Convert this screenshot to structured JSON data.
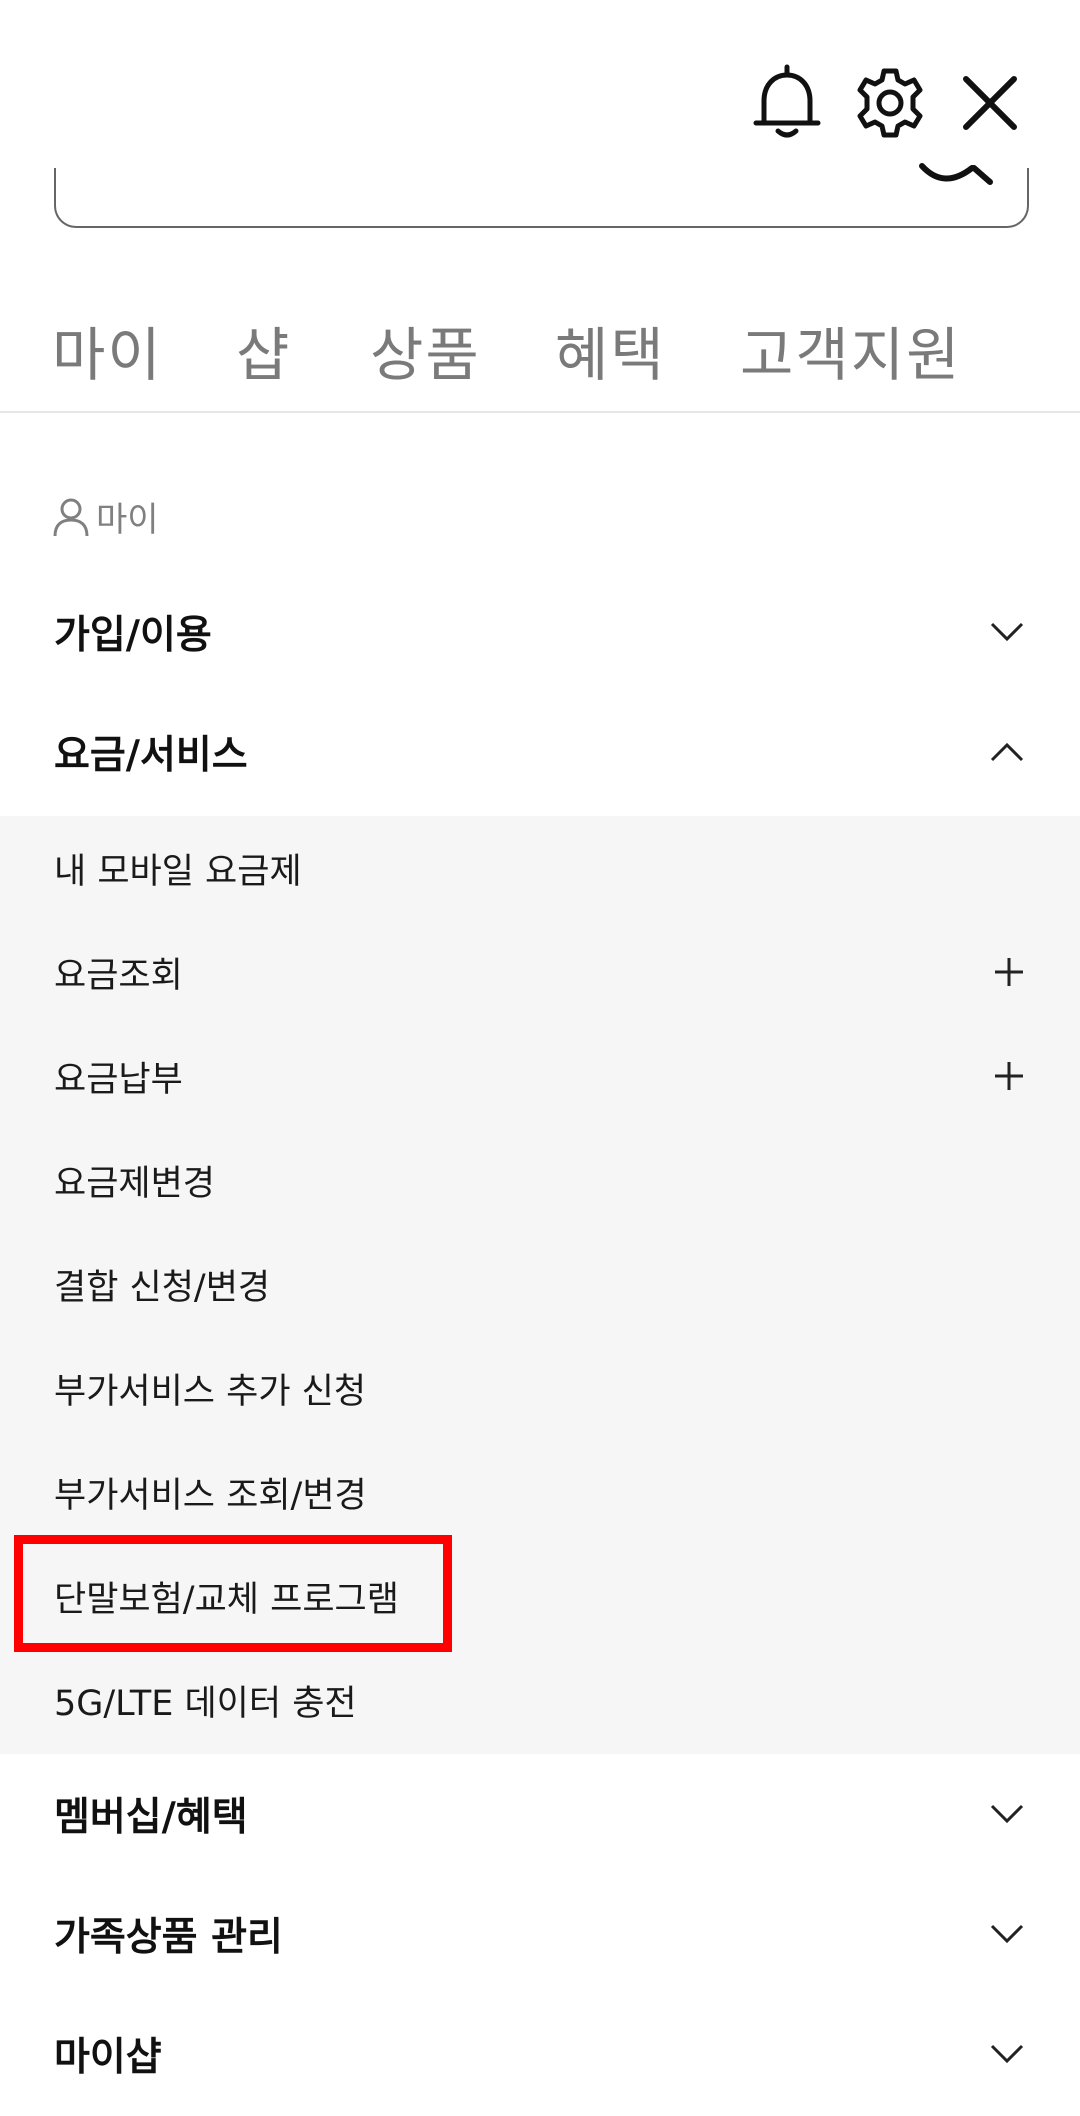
{
  "header": {
    "bell_icon": "bell-icon",
    "settings_icon": "gear-icon",
    "close_icon": "close-icon"
  },
  "search": {
    "placeholder": ""
  },
  "nav_tabs": [
    "마이",
    "샵",
    "상품",
    "혜택",
    "고객지원"
  ],
  "section": {
    "label": "마이",
    "icon": "person-icon"
  },
  "accordion": [
    {
      "title": "가입/이용",
      "expanded": false
    },
    {
      "title": "요금/서비스",
      "expanded": true
    },
    {
      "title": "멤버십/혜택",
      "expanded": false
    },
    {
      "title": "가족상품 관리",
      "expanded": false
    },
    {
      "title": "마이샵",
      "expanded": false
    }
  ],
  "submenu": [
    {
      "label": "내 모바일 요금제",
      "plus": false
    },
    {
      "label": "요금조회",
      "plus": true
    },
    {
      "label": "요금납부",
      "plus": true
    },
    {
      "label": "요금제변경",
      "plus": false
    },
    {
      "label": "결합 신청/변경",
      "plus": false
    },
    {
      "label": "부가서비스 추가 신청",
      "plus": false
    },
    {
      "label": "부가서비스 조회/변경",
      "plus": false
    },
    {
      "label": "단말보험/교체 프로그램",
      "plus": false
    },
    {
      "label": "5G/LTE 데이터 충전",
      "plus": false
    }
  ],
  "colors": {
    "highlight": "#ff0000",
    "submenu_bg": "#f6f6f6",
    "tab_text": "#7a7a7a"
  }
}
